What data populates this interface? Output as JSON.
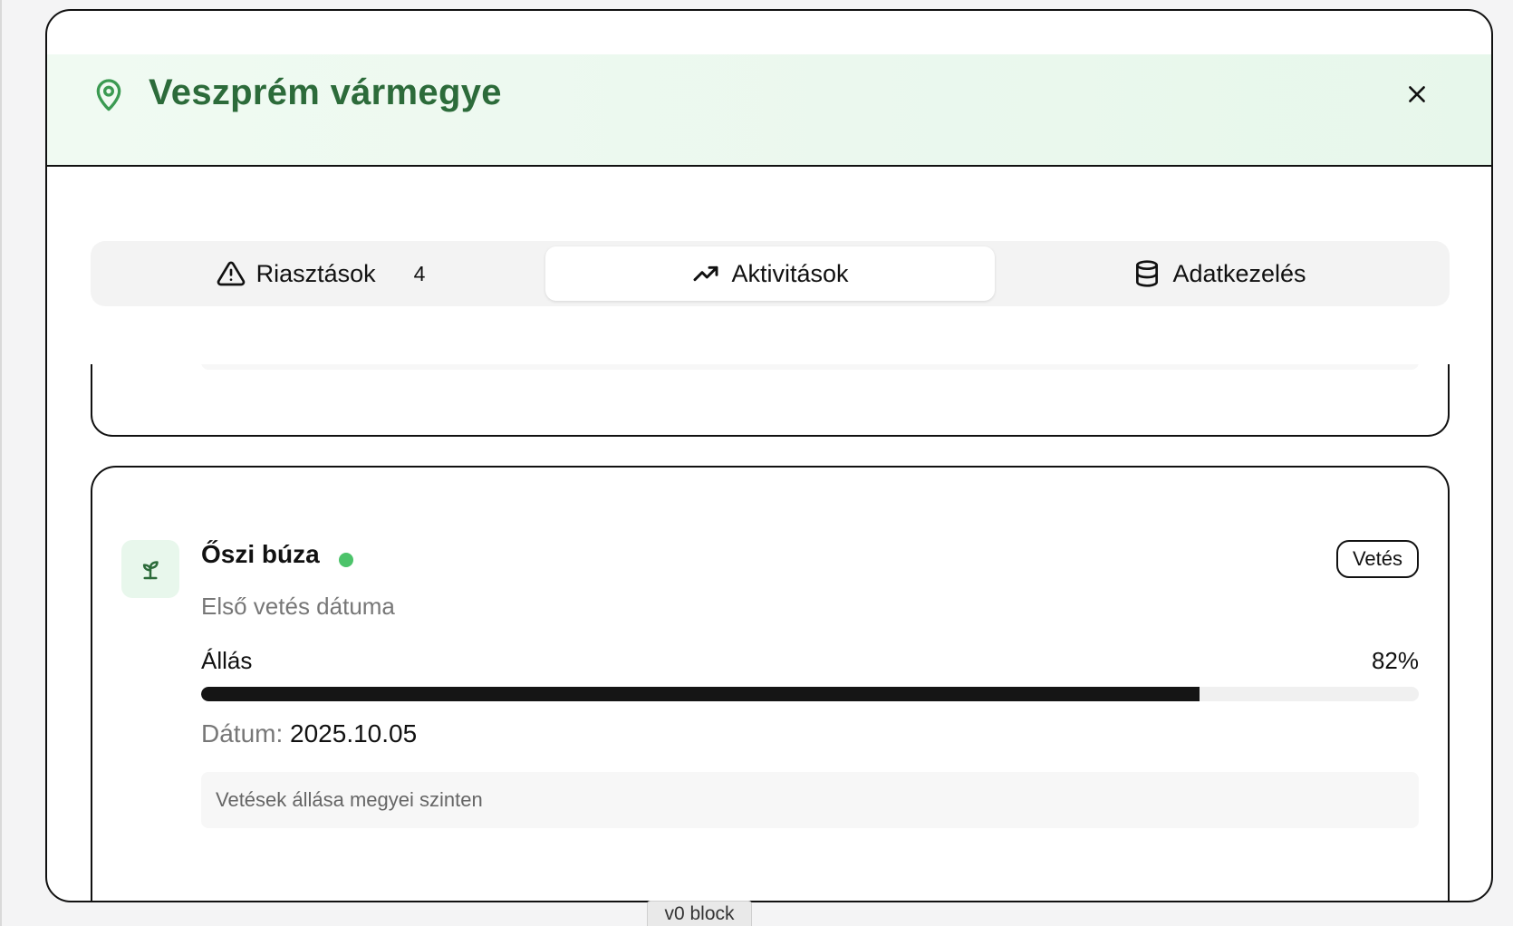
{
  "header": {
    "title": "Veszprém vármegye",
    "icon": "map-pin-icon"
  },
  "tabs": [
    {
      "label": "Riasztások",
      "count": "4",
      "icon": "alert-triangle-icon",
      "active": false
    },
    {
      "label": "Aktivitások",
      "icon": "trending-up-icon",
      "active": true
    },
    {
      "label": "Adatkezelés",
      "icon": "database-icon",
      "active": false
    }
  ],
  "activity": {
    "crop_name": "Őszi búza",
    "status_color": "#4cc36a",
    "badge": "Vetés",
    "subtitle": "Első vetés dátuma",
    "progress_label": "Állás",
    "progress_value_text": "82%",
    "progress_fraction": 0.82,
    "date_label": "Dátum:",
    "date_value": "2025.10.05",
    "note": "Vetések állása megyei szinten"
  },
  "footer_badge": "v0 block",
  "colors": {
    "brand_green": "#2c6b3a",
    "header_bg": "#e7f7eb",
    "progress_fill": "#151515"
  }
}
